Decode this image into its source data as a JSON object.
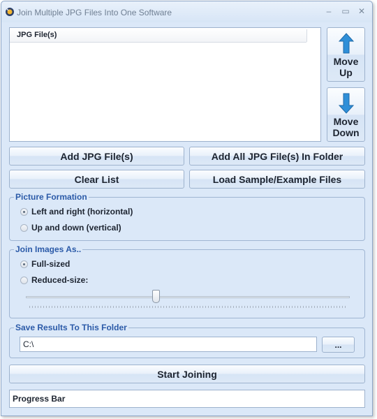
{
  "window": {
    "title": "Join Multiple JPG Files Into One Software",
    "controls": {
      "minimize": "–",
      "maximize": "▭",
      "close": "✕"
    }
  },
  "file_list": {
    "column_header": "JPG File(s)",
    "rows": []
  },
  "move_up_button": {
    "line1": "Move",
    "line2": "Up"
  },
  "move_down_button": {
    "line1": "Move",
    "line2": "Down"
  },
  "buttons": {
    "add_files": "Add JPG File(s)",
    "add_folder": "Add All JPG File(s) In Folder",
    "clear_list": "Clear List",
    "load_sample": "Load Sample/Example Files",
    "browse": "...",
    "start": "Start Joining"
  },
  "picture_formation": {
    "title": "Picture Formation",
    "options": [
      "Left and right (horizontal)",
      "Up and down (vertical)"
    ],
    "selected": "Left and right (horizontal)"
  },
  "join_images_as": {
    "title": "Join Images As..",
    "options": [
      "Full-sized",
      "Reduced-size:"
    ],
    "selected": "Full-sized",
    "size_slider_value": 0.4
  },
  "save_results": {
    "title": "Save Results To This Folder",
    "folder_value": "C:\\"
  },
  "progress": {
    "label": "Progress Bar"
  },
  "colors": {
    "window_background": "#dbe8f8",
    "group_title": "#2b5aa8",
    "arrow_blue": "#2f8fd8"
  }
}
